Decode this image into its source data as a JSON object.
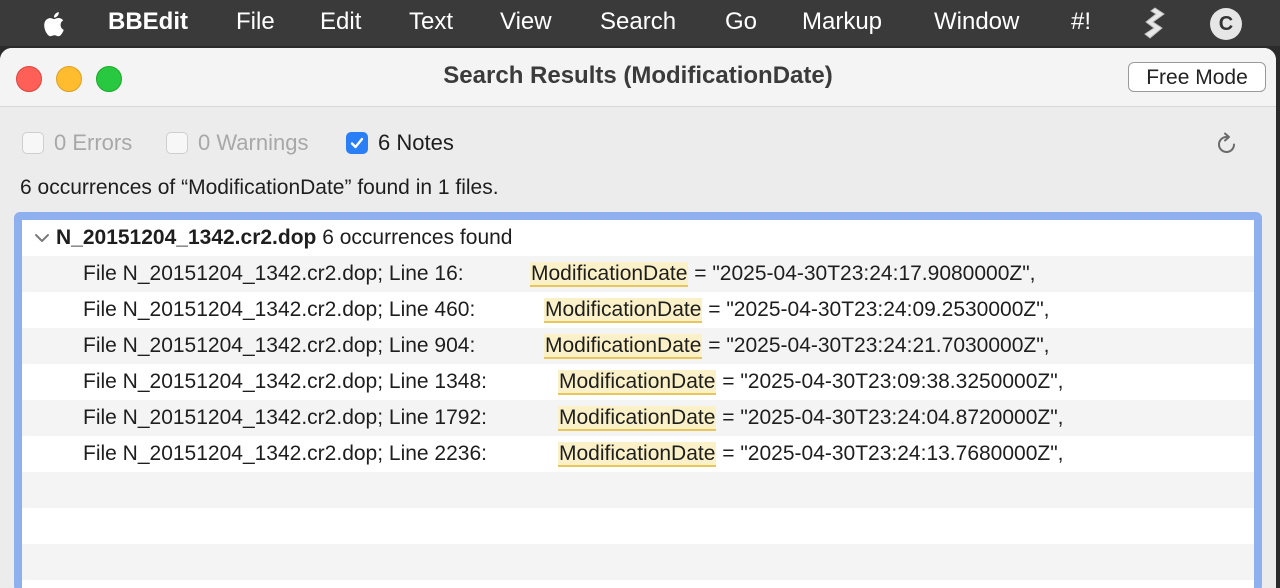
{
  "menubar": {
    "app_name": "BBEdit",
    "items": [
      "File",
      "Edit",
      "Text",
      "View",
      "Search",
      "Go",
      "Markup",
      "Window",
      "#!"
    ],
    "user_initial": "C"
  },
  "window": {
    "title": "Search Results (ModificationDate)",
    "free_mode_label": "Free Mode"
  },
  "filters": {
    "errors_label": "0 Errors",
    "warnings_label": "0 Warnings",
    "notes_label": "6 Notes",
    "notes_checked": true
  },
  "summary": "6 occurrences of “ModificationDate” found in 1 files.",
  "results": {
    "file_name": "N_20151204_1342.cr2.dop",
    "file_count_text": "6 occurrences found",
    "rows": [
      {
        "location": "File N_20151204_1342.cr2.dop; Line 16:",
        "match": "ModificationDate",
        "rest": " = \"2025-04-30T23:24:17.9080000Z\","
      },
      {
        "location": "File N_20151204_1342.cr2.dop; Line 460:",
        "match": "ModificationDate",
        "rest": " = \"2025-04-30T23:24:09.2530000Z\","
      },
      {
        "location": "File N_20151204_1342.cr2.dop; Line 904:",
        "match": "ModificationDate",
        "rest": " = \"2025-04-30T23:24:21.7030000Z\","
      },
      {
        "location": "File N_20151204_1342.cr2.dop; Line 1348:",
        "match": "ModificationDate",
        "rest": " = \"2025-04-30T23:09:38.3250000Z\","
      },
      {
        "location": "File N_20151204_1342.cr2.dop; Line 1792:",
        "match": "ModificationDate",
        "rest": " = \"2025-04-30T23:24:04.8720000Z\","
      },
      {
        "location": "File N_20151204_1342.cr2.dop; Line 2236:",
        "match": "ModificationDate",
        "rest": " = \"2025-04-30T23:24:13.7680000Z\","
      }
    ]
  },
  "colors": {
    "accent": "#2a7ff6",
    "highlight": "#fbf1c8",
    "highlight_underline": "#e8c659",
    "selection_frame": "#8fb0ee"
  }
}
